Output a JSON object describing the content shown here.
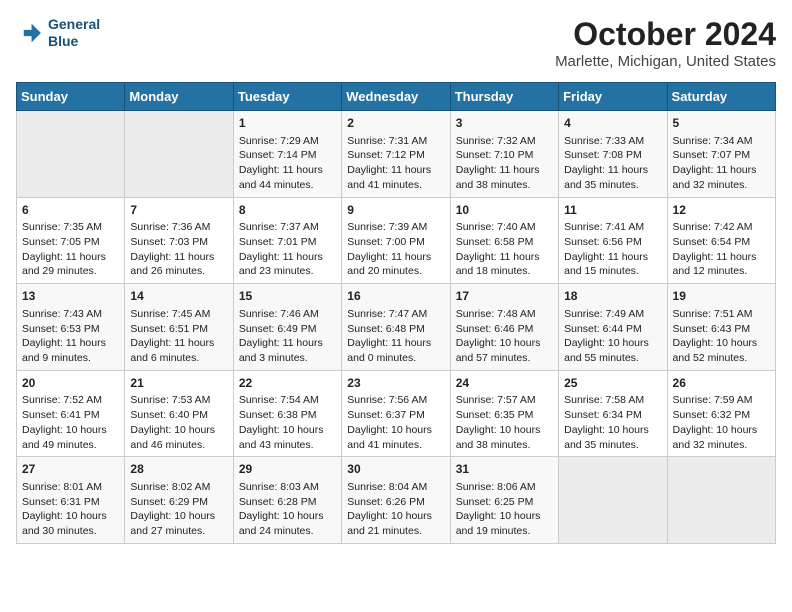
{
  "header": {
    "logo_line1": "General",
    "logo_line2": "Blue",
    "title": "October 2024",
    "subtitle": "Marlette, Michigan, United States"
  },
  "days_of_week": [
    "Sunday",
    "Monday",
    "Tuesday",
    "Wednesday",
    "Thursday",
    "Friday",
    "Saturday"
  ],
  "weeks": [
    [
      {
        "day": "",
        "sunrise": "",
        "sunset": "",
        "daylight": "",
        "empty": true
      },
      {
        "day": "",
        "sunrise": "",
        "sunset": "",
        "daylight": "",
        "empty": true
      },
      {
        "day": "1",
        "sunrise": "Sunrise: 7:29 AM",
        "sunset": "Sunset: 7:14 PM",
        "daylight": "Daylight: 11 hours and 44 minutes.",
        "empty": false
      },
      {
        "day": "2",
        "sunrise": "Sunrise: 7:31 AM",
        "sunset": "Sunset: 7:12 PM",
        "daylight": "Daylight: 11 hours and 41 minutes.",
        "empty": false
      },
      {
        "day": "3",
        "sunrise": "Sunrise: 7:32 AM",
        "sunset": "Sunset: 7:10 PM",
        "daylight": "Daylight: 11 hours and 38 minutes.",
        "empty": false
      },
      {
        "day": "4",
        "sunrise": "Sunrise: 7:33 AM",
        "sunset": "Sunset: 7:08 PM",
        "daylight": "Daylight: 11 hours and 35 minutes.",
        "empty": false
      },
      {
        "day": "5",
        "sunrise": "Sunrise: 7:34 AM",
        "sunset": "Sunset: 7:07 PM",
        "daylight": "Daylight: 11 hours and 32 minutes.",
        "empty": false
      }
    ],
    [
      {
        "day": "6",
        "sunrise": "Sunrise: 7:35 AM",
        "sunset": "Sunset: 7:05 PM",
        "daylight": "Daylight: 11 hours and 29 minutes.",
        "empty": false
      },
      {
        "day": "7",
        "sunrise": "Sunrise: 7:36 AM",
        "sunset": "Sunset: 7:03 PM",
        "daylight": "Daylight: 11 hours and 26 minutes.",
        "empty": false
      },
      {
        "day": "8",
        "sunrise": "Sunrise: 7:37 AM",
        "sunset": "Sunset: 7:01 PM",
        "daylight": "Daylight: 11 hours and 23 minutes.",
        "empty": false
      },
      {
        "day": "9",
        "sunrise": "Sunrise: 7:39 AM",
        "sunset": "Sunset: 7:00 PM",
        "daylight": "Daylight: 11 hours and 20 minutes.",
        "empty": false
      },
      {
        "day": "10",
        "sunrise": "Sunrise: 7:40 AM",
        "sunset": "Sunset: 6:58 PM",
        "daylight": "Daylight: 11 hours and 18 minutes.",
        "empty": false
      },
      {
        "day": "11",
        "sunrise": "Sunrise: 7:41 AM",
        "sunset": "Sunset: 6:56 PM",
        "daylight": "Daylight: 11 hours and 15 minutes.",
        "empty": false
      },
      {
        "day": "12",
        "sunrise": "Sunrise: 7:42 AM",
        "sunset": "Sunset: 6:54 PM",
        "daylight": "Daylight: 11 hours and 12 minutes.",
        "empty": false
      }
    ],
    [
      {
        "day": "13",
        "sunrise": "Sunrise: 7:43 AM",
        "sunset": "Sunset: 6:53 PM",
        "daylight": "Daylight: 11 hours and 9 minutes.",
        "empty": false
      },
      {
        "day": "14",
        "sunrise": "Sunrise: 7:45 AM",
        "sunset": "Sunset: 6:51 PM",
        "daylight": "Daylight: 11 hours and 6 minutes.",
        "empty": false
      },
      {
        "day": "15",
        "sunrise": "Sunrise: 7:46 AM",
        "sunset": "Sunset: 6:49 PM",
        "daylight": "Daylight: 11 hours and 3 minutes.",
        "empty": false
      },
      {
        "day": "16",
        "sunrise": "Sunrise: 7:47 AM",
        "sunset": "Sunset: 6:48 PM",
        "daylight": "Daylight: 11 hours and 0 minutes.",
        "empty": false
      },
      {
        "day": "17",
        "sunrise": "Sunrise: 7:48 AM",
        "sunset": "Sunset: 6:46 PM",
        "daylight": "Daylight: 10 hours and 57 minutes.",
        "empty": false
      },
      {
        "day": "18",
        "sunrise": "Sunrise: 7:49 AM",
        "sunset": "Sunset: 6:44 PM",
        "daylight": "Daylight: 10 hours and 55 minutes.",
        "empty": false
      },
      {
        "day": "19",
        "sunrise": "Sunrise: 7:51 AM",
        "sunset": "Sunset: 6:43 PM",
        "daylight": "Daylight: 10 hours and 52 minutes.",
        "empty": false
      }
    ],
    [
      {
        "day": "20",
        "sunrise": "Sunrise: 7:52 AM",
        "sunset": "Sunset: 6:41 PM",
        "daylight": "Daylight: 10 hours and 49 minutes.",
        "empty": false
      },
      {
        "day": "21",
        "sunrise": "Sunrise: 7:53 AM",
        "sunset": "Sunset: 6:40 PM",
        "daylight": "Daylight: 10 hours and 46 minutes.",
        "empty": false
      },
      {
        "day": "22",
        "sunrise": "Sunrise: 7:54 AM",
        "sunset": "Sunset: 6:38 PM",
        "daylight": "Daylight: 10 hours and 43 minutes.",
        "empty": false
      },
      {
        "day": "23",
        "sunrise": "Sunrise: 7:56 AM",
        "sunset": "Sunset: 6:37 PM",
        "daylight": "Daylight: 10 hours and 41 minutes.",
        "empty": false
      },
      {
        "day": "24",
        "sunrise": "Sunrise: 7:57 AM",
        "sunset": "Sunset: 6:35 PM",
        "daylight": "Daylight: 10 hours and 38 minutes.",
        "empty": false
      },
      {
        "day": "25",
        "sunrise": "Sunrise: 7:58 AM",
        "sunset": "Sunset: 6:34 PM",
        "daylight": "Daylight: 10 hours and 35 minutes.",
        "empty": false
      },
      {
        "day": "26",
        "sunrise": "Sunrise: 7:59 AM",
        "sunset": "Sunset: 6:32 PM",
        "daylight": "Daylight: 10 hours and 32 minutes.",
        "empty": false
      }
    ],
    [
      {
        "day": "27",
        "sunrise": "Sunrise: 8:01 AM",
        "sunset": "Sunset: 6:31 PM",
        "daylight": "Daylight: 10 hours and 30 minutes.",
        "empty": false
      },
      {
        "day": "28",
        "sunrise": "Sunrise: 8:02 AM",
        "sunset": "Sunset: 6:29 PM",
        "daylight": "Daylight: 10 hours and 27 minutes.",
        "empty": false
      },
      {
        "day": "29",
        "sunrise": "Sunrise: 8:03 AM",
        "sunset": "Sunset: 6:28 PM",
        "daylight": "Daylight: 10 hours and 24 minutes.",
        "empty": false
      },
      {
        "day": "30",
        "sunrise": "Sunrise: 8:04 AM",
        "sunset": "Sunset: 6:26 PM",
        "daylight": "Daylight: 10 hours and 21 minutes.",
        "empty": false
      },
      {
        "day": "31",
        "sunrise": "Sunrise: 8:06 AM",
        "sunset": "Sunset: 6:25 PM",
        "daylight": "Daylight: 10 hours and 19 minutes.",
        "empty": false
      },
      {
        "day": "",
        "sunrise": "",
        "sunset": "",
        "daylight": "",
        "empty": true
      },
      {
        "day": "",
        "sunrise": "",
        "sunset": "",
        "daylight": "",
        "empty": true
      }
    ]
  ]
}
